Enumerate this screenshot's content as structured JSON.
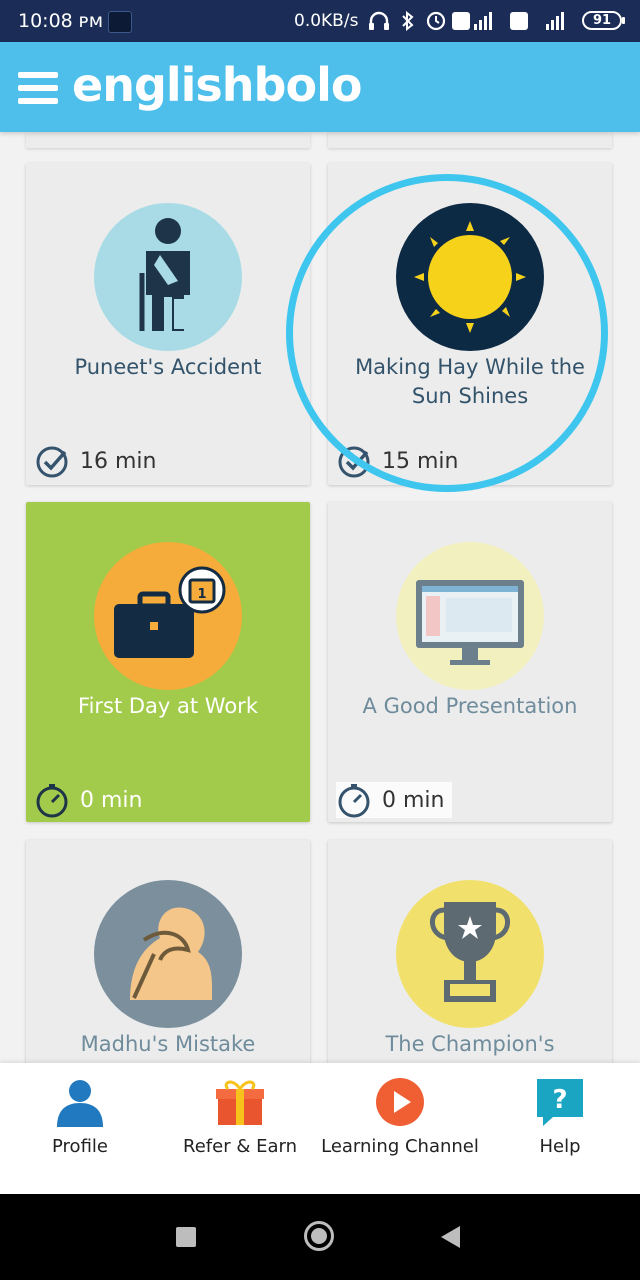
{
  "status_bar": {
    "time": "10:08 ᴘᴍ",
    "speed": "0.0KB/s",
    "battery": "91"
  },
  "header": {
    "brand": "englishbolo",
    "menu_icon": "hamburger-menu-icon"
  },
  "cards": [
    {
      "title": "Puneet's Accident",
      "duration": "16 min",
      "icon": "injured-man-icon"
    },
    {
      "title": "Making Hay While the Sun Shines",
      "duration": "15 min",
      "icon": "sun-icon"
    },
    {
      "title": "First Day at Work",
      "duration": "0 min",
      "icon": "briefcase-calendar-icon"
    },
    {
      "title": "A Good Presentation",
      "duration": "0 min",
      "icon": "computer-monitor-icon"
    },
    {
      "title": "Madhu's Mistake",
      "icon": "facepalm-icon"
    },
    {
      "title": "The Champion's",
      "icon": "trophy-icon"
    }
  ],
  "bottom_nav": [
    {
      "label": "Profile",
      "icon": "profile-icon"
    },
    {
      "label": "Refer & Earn",
      "icon": "gift-icon"
    },
    {
      "label": "Learning Channel",
      "icon": "play-icon"
    },
    {
      "label": "Help",
      "icon": "help-icon"
    }
  ],
  "colors": {
    "header": "#4dbfea",
    "status_bar": "#1b2d57",
    "card_bg": "#ececec",
    "card_active": "#a2cb4b",
    "highlight_ring": "#3ec6ee"
  }
}
